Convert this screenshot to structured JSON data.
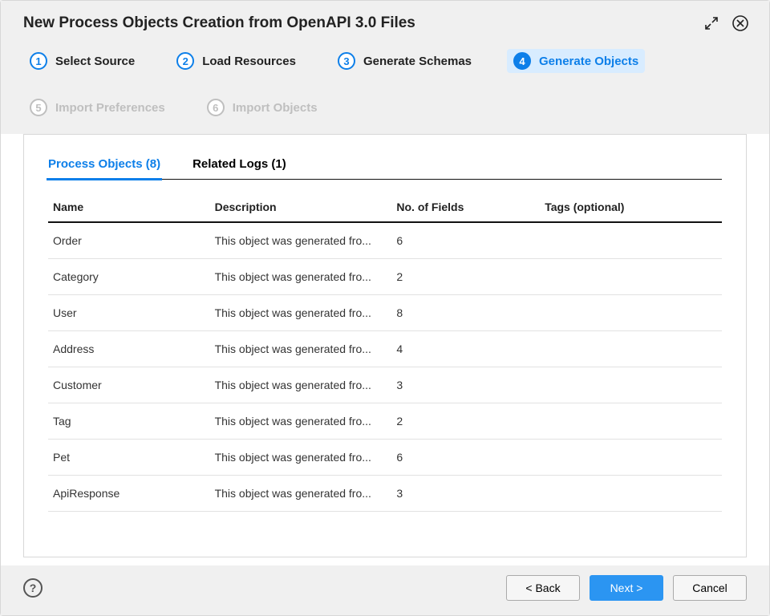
{
  "dialog_title": "New Process Objects Creation from OpenAPI 3.0 Files",
  "steps": [
    {
      "num": "1",
      "label": "Select Source",
      "state": "done"
    },
    {
      "num": "2",
      "label": "Load Resources",
      "state": "done"
    },
    {
      "num": "3",
      "label": "Generate Schemas",
      "state": "done"
    },
    {
      "num": "4",
      "label": "Generate Objects",
      "state": "active"
    },
    {
      "num": "5",
      "label": "Import Preferences",
      "state": "pending"
    },
    {
      "num": "6",
      "label": "Import Objects",
      "state": "pending"
    }
  ],
  "tabs": {
    "process_objects": "Process Objects (8)",
    "related_logs": "Related Logs (1)",
    "active": "process_objects"
  },
  "columns": {
    "name": "Name",
    "description": "Description",
    "fields": "No. of Fields",
    "tags": "Tags (optional)"
  },
  "rows": [
    {
      "name": "Order",
      "description": "This object was generated fro...",
      "fields": "6",
      "tags": ""
    },
    {
      "name": "Category",
      "description": "This object was generated fro...",
      "fields": "2",
      "tags": ""
    },
    {
      "name": "User",
      "description": "This object was generated fro...",
      "fields": "8",
      "tags": ""
    },
    {
      "name": "Address",
      "description": "This object was generated fro...",
      "fields": "4",
      "tags": ""
    },
    {
      "name": "Customer",
      "description": "This object was generated fro...",
      "fields": "3",
      "tags": ""
    },
    {
      "name": "Tag",
      "description": "This object was generated fro...",
      "fields": "2",
      "tags": ""
    },
    {
      "name": "Pet",
      "description": "This object was generated fro...",
      "fields": "6",
      "tags": ""
    },
    {
      "name": "ApiResponse",
      "description": "This object was generated fro...",
      "fields": "3",
      "tags": ""
    }
  ],
  "buttons": {
    "back": "< Back",
    "next": "Next >",
    "cancel": "Cancel"
  }
}
